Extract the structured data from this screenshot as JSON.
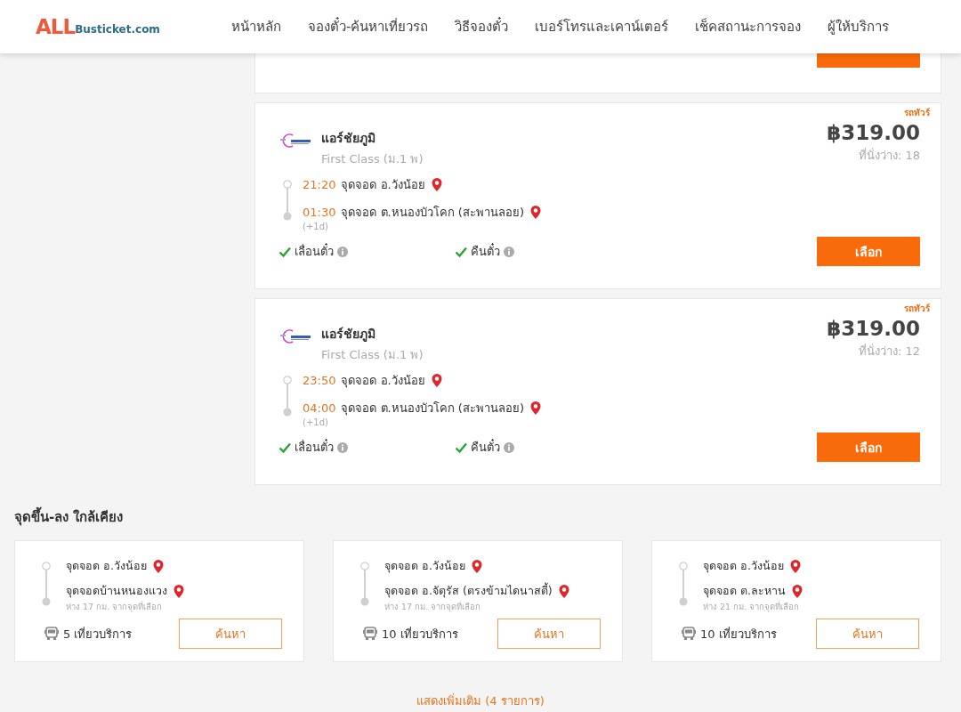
{
  "header": {
    "logo": {
      "accent": "ALL",
      "rest": "Busticket.com"
    },
    "nav": [
      {
        "label": "หน้าหลัก"
      },
      {
        "label": "จองตั๋ว-ค้นหาเที่ยวรถ"
      },
      {
        "label": "วิธีจองตั๋ว"
      },
      {
        "label": "เบอร์โทรและเคาน์เตอร์"
      },
      {
        "label": "เช็คสถานะการจอง"
      },
      {
        "label": "ผู้ให้บริการ"
      }
    ]
  },
  "trips": [
    {
      "badge": "รถทัวร์",
      "operator": "แอร์ชัยภูมิ",
      "service_class": "First Class (ม.1 พ)",
      "price": "฿319.00",
      "seats": "ที่นั่งว่าง: 18",
      "stops": [
        {
          "time": "21:20",
          "place": "จุดจอด อ.วังน้อย"
        },
        {
          "time": "01:30",
          "place": "จุดจอด ต.หนองบัวโคก (สะพานลอย)",
          "day_offset": "(+1d)"
        }
      ],
      "features": [
        {
          "label": "เลื่อนตั๋ว",
          "available": true
        },
        {
          "label": "คืนตั๋ว",
          "available": true
        }
      ],
      "button": "เลือก"
    },
    {
      "badge": "รถทัวร์",
      "operator": "แอร์ชัยภูมิ",
      "service_class": "First Class (ม.1 พ)",
      "price": "฿319.00",
      "seats": "ที่นั่งว่าง: 12",
      "stops": [
        {
          "time": "23:50",
          "place": "จุดจอด อ.วังน้อย"
        },
        {
          "time": "04:00",
          "place": "จุดจอด ต.หนองบัวโคก (สะพานลอย)",
          "day_offset": "(+1d)"
        }
      ],
      "features": [
        {
          "label": "เลื่อนตั๋ว",
          "available": true
        },
        {
          "label": "คืนตั๋ว",
          "available": true
        }
      ],
      "button": "เลือก"
    }
  ],
  "nearby": {
    "title": "จุดขึ้น-ลง ใกล้เคียง",
    "cards": [
      {
        "stops": [
          {
            "place": "จุดจอด อ.วังน้อย"
          },
          {
            "place": "จุดจอดบ้านหนองแวง",
            "note": "ห่าง 17 กม. จากจุดที่เลือก"
          }
        ],
        "trips": "5 เที่ยวบริการ",
        "button": "ค้นหา"
      },
      {
        "stops": [
          {
            "place": "จุดจอด อ.วังน้อย"
          },
          {
            "place": "จุดจอด อ.จัตุรัส (ตรงข้ามไดนาสตี้)",
            "note": "ห่าง 17 กม. จากจุดที่เลือก"
          }
        ],
        "trips": "10 เที่ยวบริการ",
        "button": "ค้นหา"
      },
      {
        "stops": [
          {
            "place": "จุดจอด อ.วังน้อย"
          },
          {
            "place": "จุดจอด ต.ละหาน",
            "note": "ห่าง 21 กม. จากจุดที่เลือก"
          }
        ],
        "trips": "10 เที่ยวบริการ",
        "button": "ค้นหา"
      }
    ],
    "more_link": "แสดงเพิ่มเติม (4 รายการ)"
  }
}
